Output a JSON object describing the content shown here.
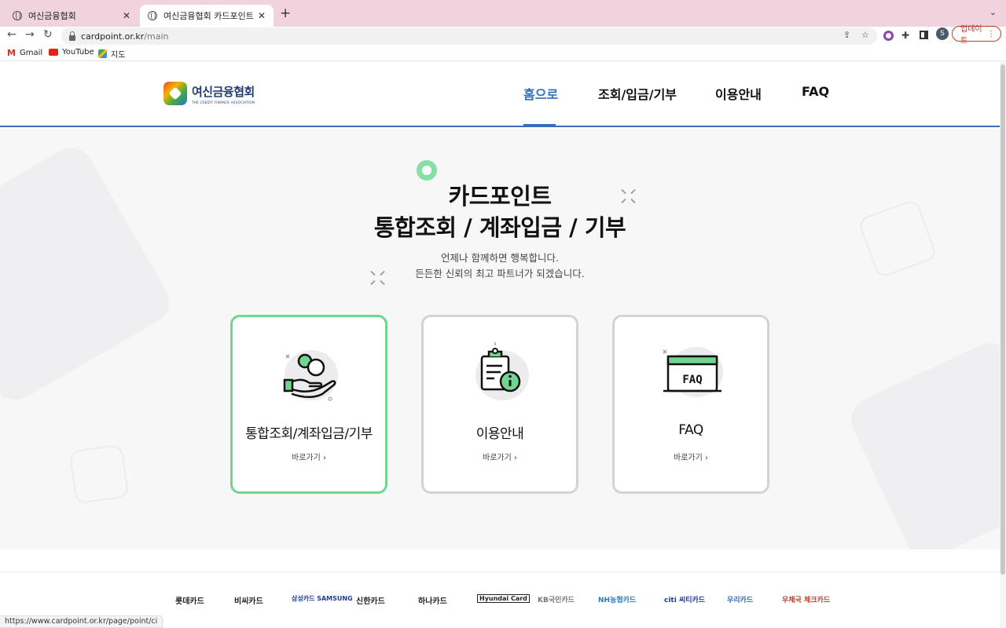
{
  "browser": {
    "tabs": [
      {
        "title": "여신금융협회",
        "active": false
      },
      {
        "title": "여신금융협회 카드포인트 통합조회 /",
        "active": true
      }
    ],
    "new_tab": "+",
    "url_host": "cardpoint.or.kr",
    "url_path": "/main",
    "profile_initial": "S",
    "update_label": "업데이트",
    "bookmarks": [
      "Gmail",
      "YouTube",
      "지도"
    ],
    "status_url": "https://www.cardpoint.or.kr/page/point/ci"
  },
  "header": {
    "logo_ko": "여신금융협회",
    "logo_en": "THE CREDIT FINANCE ASSOCIATION",
    "nav": [
      {
        "label": "홈으로",
        "current": true
      },
      {
        "label": "조회/입금/기부",
        "current": false
      },
      {
        "label": "이용안내",
        "current": false
      },
      {
        "label": "FAQ",
        "current": false
      }
    ]
  },
  "hero": {
    "title_line1": "카드포인트",
    "title_line2": "통합조회 / 계좌입금 / 기부",
    "sub_line1": "언제나 함께하면 행복합니다.",
    "sub_line2": "든든한 신뢰의 최고 파트너가 되겠습니다."
  },
  "cards": [
    {
      "title": "통합조회/계좌입금/기부",
      "link": "바로가기",
      "icon": "hand-coin-icon",
      "selected": true
    },
    {
      "title": "이용안내",
      "link": "바로가기",
      "icon": "clipboard-info-icon",
      "selected": false
    },
    {
      "title": "FAQ",
      "link": "바로가기",
      "icon": "faq-window-icon",
      "icon_text": "FAQ",
      "selected": false
    }
  ],
  "partners": [
    {
      "name": "롯데카드",
      "color": "#222222"
    },
    {
      "name": "비씨카드",
      "color": "#222222"
    },
    {
      "name": "삼성카드 SAMSUNG",
      "color": "#1f3d9a"
    },
    {
      "name": "신한카드",
      "color": "#222222"
    },
    {
      "name": "하나카드",
      "color": "#222222"
    },
    {
      "name": "Hyundai Card",
      "color": "#222222"
    },
    {
      "name": "KB국민카드",
      "color": "#777777"
    },
    {
      "name": "NH농협카드",
      "color": "#2a7ab8"
    },
    {
      "name": "citi 씨티카드",
      "color": "#1f3d9a"
    },
    {
      "name": "우리카드",
      "color": "#2a6fb8"
    },
    {
      "name": "우체국 체크카드",
      "color": "#c0392b"
    }
  ],
  "colors": {
    "accent_blue": "#2f6fbf",
    "accent_green": "#6fd58f",
    "tabbar_pink": "#f1d3de",
    "update_red": "#c0392b"
  }
}
